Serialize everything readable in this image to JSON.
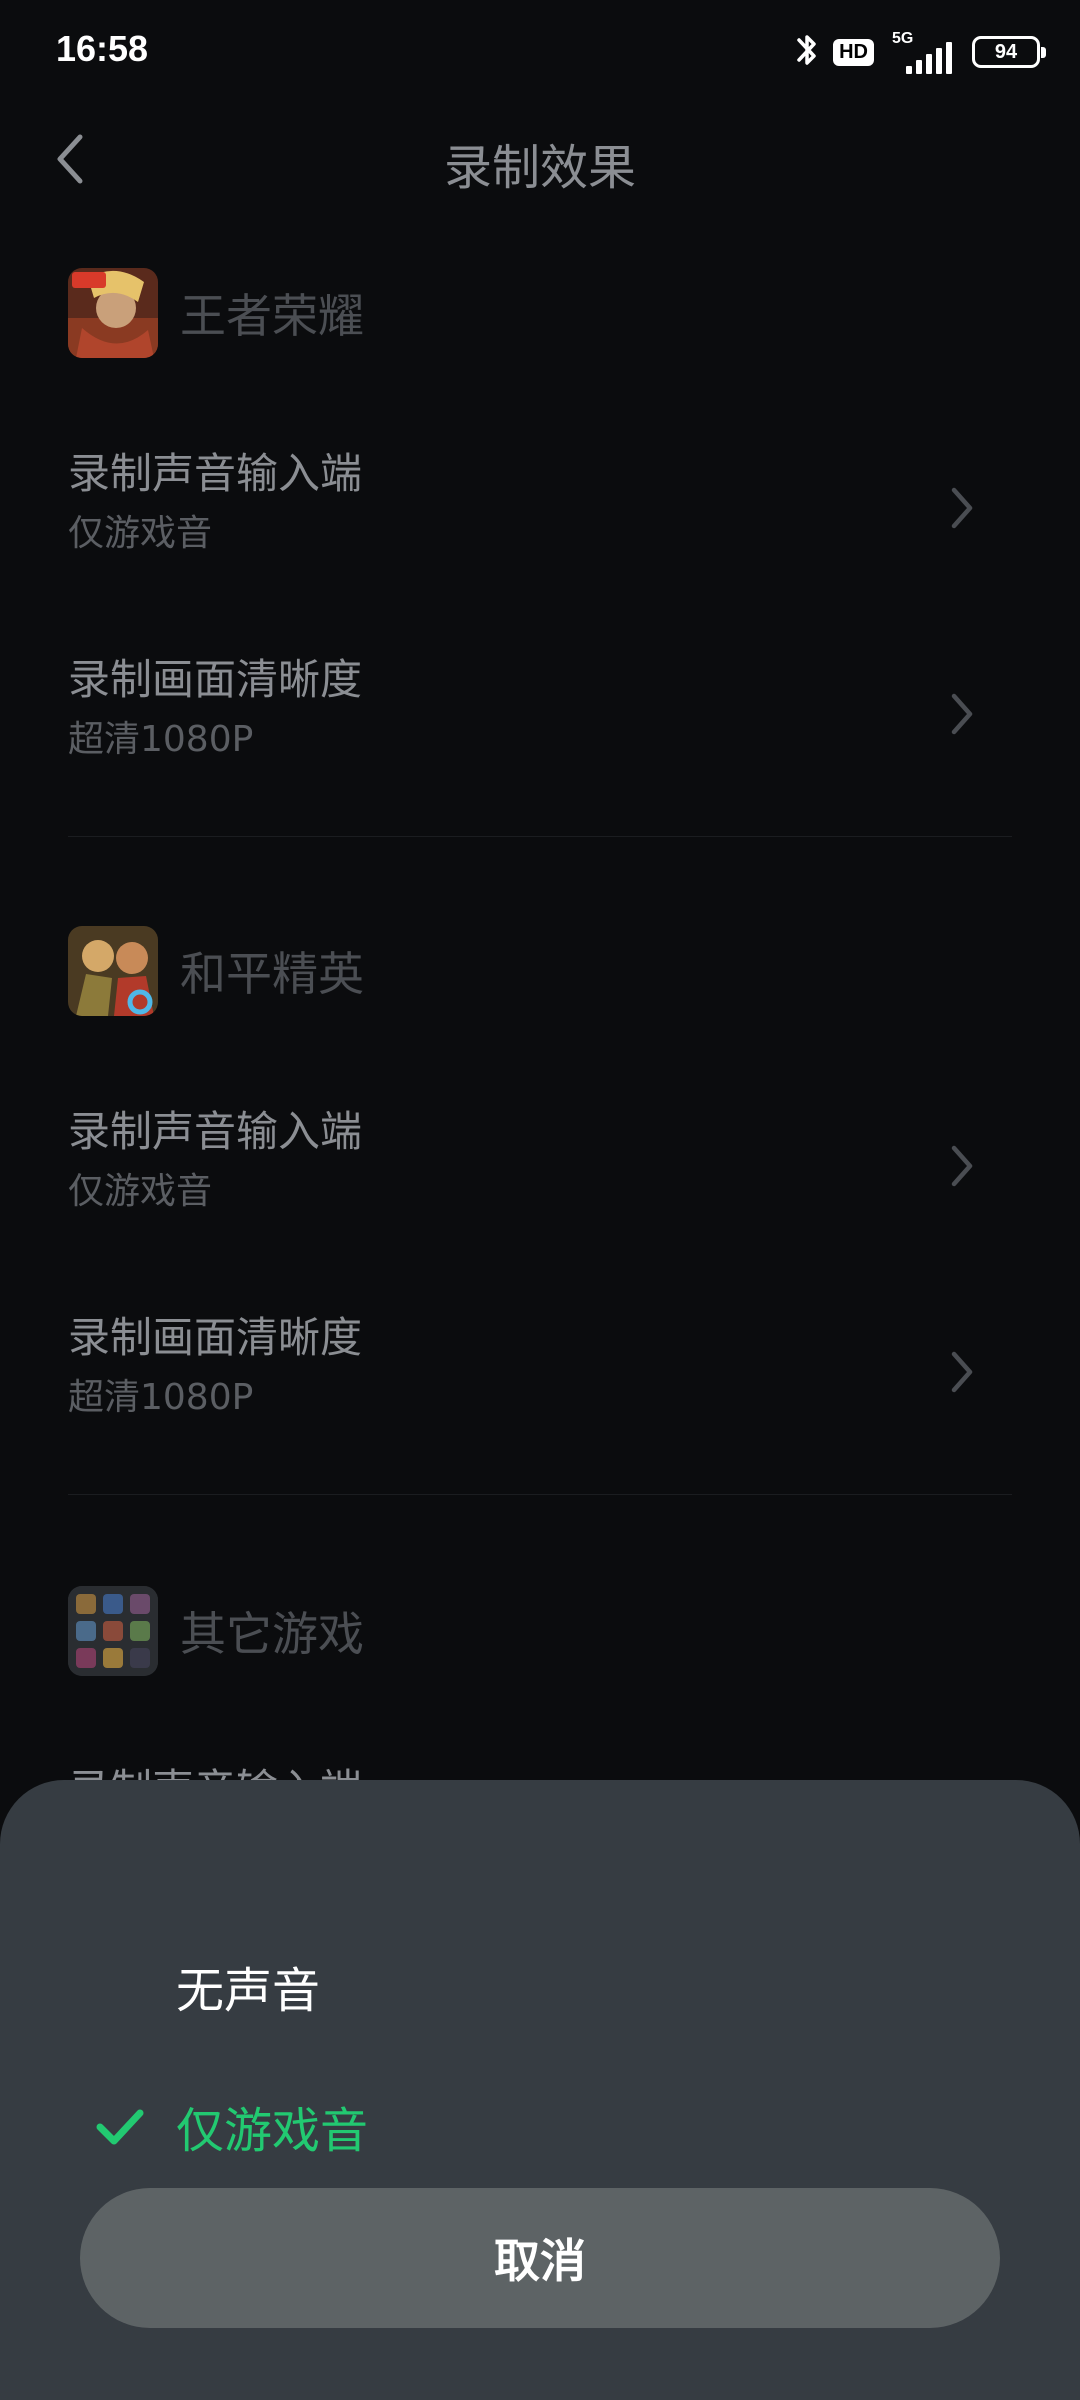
{
  "status_bar": {
    "time": "16:58",
    "badge": "HD",
    "network": "5G",
    "battery": "94",
    "icons": [
      "bluetooth-icon",
      "hd-icon",
      "signal-icon",
      "battery-icon"
    ]
  },
  "header": {
    "title": "录制效果",
    "back_icon": "chevron-left-icon"
  },
  "sections": [
    {
      "game": "王者荣耀",
      "icon": "honor-of-kings-app-icon",
      "rows": [
        {
          "title": "录制声音输入端",
          "value": "仅游戏音"
        },
        {
          "title": "录制画面清晰度",
          "value": "超清1080P"
        }
      ]
    },
    {
      "game": "和平精英",
      "icon": "peacekeeper-elite-app-icon",
      "rows": [
        {
          "title": "录制声音输入端",
          "value": "仅游戏音"
        },
        {
          "title": "录制画面清晰度",
          "value": "超清1080P"
        }
      ]
    },
    {
      "game": "其它游戏",
      "icon": "other-games-grid-icon",
      "rows": [
        {
          "title": "录制声音输入端",
          "value": ""
        }
      ]
    }
  ],
  "sheet": {
    "options": [
      {
        "label": "无声音",
        "selected": false
      },
      {
        "label": "仅游戏音",
        "selected": true
      }
    ],
    "cancel_label": "取消"
  },
  "colors": {
    "background": "#0b0c0e",
    "sheet": "#363c42",
    "accent_green": "#22c971",
    "cancel_button": "#5d6365"
  }
}
